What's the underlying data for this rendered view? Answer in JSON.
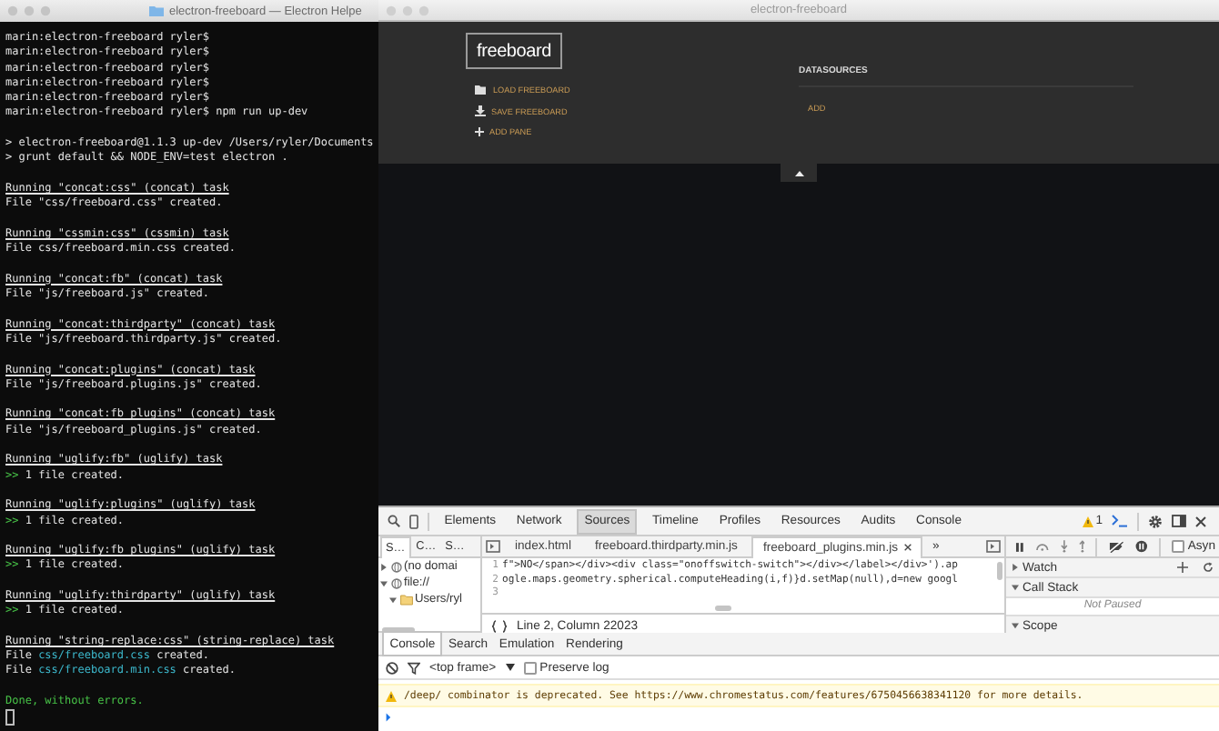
{
  "terminal": {
    "title": "electron-freeboard — Electron Helpe",
    "lines": [
      {
        "kind": "prompt",
        "text": "marin:electron-freeboard ryler$"
      },
      {
        "kind": "prompt",
        "text": "marin:electron-freeboard ryler$"
      },
      {
        "kind": "prompt",
        "text": "marin:electron-freeboard ryler$"
      },
      {
        "kind": "prompt",
        "text": "marin:electron-freeboard ryler$"
      },
      {
        "kind": "prompt",
        "text": "marin:electron-freeboard ryler$"
      },
      {
        "kind": "prompt",
        "text": "marin:electron-freeboard ryler$ npm run up-dev"
      },
      {
        "kind": "blank"
      },
      {
        "kind": "output",
        "text": "> electron-freeboard@1.1.3 up-dev /Users/ryler/Documents"
      },
      {
        "kind": "output",
        "text": "> grunt default && NODE_ENV=test electron ."
      },
      {
        "kind": "blank"
      },
      {
        "kind": "task",
        "text": "Running \"concat:css\" (concat) task"
      },
      {
        "kind": "output",
        "text": "File \"css/freeboard.css\" created."
      },
      {
        "kind": "blank"
      },
      {
        "kind": "task",
        "text": "Running \"cssmin:css\" (cssmin) task"
      },
      {
        "kind": "output",
        "text": "File css/freeboard.min.css created."
      },
      {
        "kind": "blank"
      },
      {
        "kind": "task",
        "text": "Running \"concat:fb\" (concat) task"
      },
      {
        "kind": "output",
        "text": "File \"js/freeboard.js\" created."
      },
      {
        "kind": "blank"
      },
      {
        "kind": "task",
        "text": "Running \"concat:thirdparty\" (concat) task"
      },
      {
        "kind": "output",
        "text": "File \"js/freeboard.thirdparty.js\" created."
      },
      {
        "kind": "blank"
      },
      {
        "kind": "task",
        "text": "Running \"concat:plugins\" (concat) task"
      },
      {
        "kind": "output",
        "text": "File \"js/freeboard.plugins.js\" created."
      },
      {
        "kind": "blank"
      },
      {
        "kind": "task",
        "text": "Running \"concat:fb_plugins\" (concat) task"
      },
      {
        "kind": "output",
        "text": "File \"js/freeboard_plugins.js\" created."
      },
      {
        "kind": "blank"
      },
      {
        "kind": "task",
        "text": "Running \"uglify:fb\" (uglify) task"
      },
      {
        "kind": "ok",
        "mark": ">>",
        "text": "1 file created."
      },
      {
        "kind": "blank"
      },
      {
        "kind": "task",
        "text": "Running \"uglify:plugins\" (uglify) task"
      },
      {
        "kind": "ok",
        "mark": ">>",
        "text": "1 file created."
      },
      {
        "kind": "blank"
      },
      {
        "kind": "task",
        "text": "Running \"uglify:fb_plugins\" (uglify) task"
      },
      {
        "kind": "ok",
        "mark": ">>",
        "text": "1 file created."
      },
      {
        "kind": "blank"
      },
      {
        "kind": "task",
        "text": "Running \"uglify:thirdparty\" (uglify) task"
      },
      {
        "kind": "ok",
        "mark": ">>",
        "text": "1 file created."
      },
      {
        "kind": "blank"
      },
      {
        "kind": "task",
        "text": "Running \"string-replace:css\" (string-replace) task"
      },
      {
        "kind": "file",
        "prefix": "File",
        "path": "css/freeboard.css",
        "suffix": "created."
      },
      {
        "kind": "file",
        "prefix": "File",
        "path": "css/freeboard.min.css",
        "suffix": "created."
      },
      {
        "kind": "blank"
      },
      {
        "kind": "done",
        "text": "Done, without errors."
      },
      {
        "kind": "cursor"
      }
    ]
  },
  "app_window": {
    "title": "electron-freeboard",
    "logo": "freeboard",
    "menu": [
      {
        "label": "LOAD FREEBOARD"
      },
      {
        "label": "SAVE FREEBOARD"
      },
      {
        "label": "ADD PANE"
      }
    ],
    "datasources": {
      "heading": "DATASOURCES",
      "add": "ADD"
    }
  },
  "devtools": {
    "panel_tabs": [
      {
        "label": "Elements",
        "selected": false
      },
      {
        "label": "Network",
        "selected": false
      },
      {
        "label": "Sources",
        "selected": true
      },
      {
        "label": "Timeline",
        "selected": false
      },
      {
        "label": "Profiles",
        "selected": false
      },
      {
        "label": "Resources",
        "selected": false
      },
      {
        "label": "Audits",
        "selected": false
      },
      {
        "label": "Console",
        "selected": false
      }
    ],
    "warning_count": "1",
    "navigator_tabs": [
      {
        "label": "S…",
        "selected": true
      },
      {
        "label": "C…",
        "selected": false
      },
      {
        "label": "S…",
        "selected": false
      }
    ],
    "tree": [
      {
        "label": "(no domai",
        "expanded": false
      },
      {
        "label": "file://",
        "expanded": true,
        "children": [
          {
            "label": "Users/ryl",
            "expanded": true
          }
        ]
      }
    ],
    "editor_tabs": [
      {
        "label": "index.html",
        "selected": false
      },
      {
        "label": "freeboard.thirdparty.min.js",
        "selected": false
      },
      {
        "label": "freeboard_plugins.min.js",
        "selected": true
      }
    ],
    "overflow": "»",
    "code_lines": [
      {
        "number": "1",
        "text": "f\">NO</span></div><div class=\"onoffswitch-switch\"></div></label></div>').ap"
      },
      {
        "number": "2",
        "text": "ogle.maps.geometry.spherical.computeHeading(i,f)}d.setMap(null),d=new googl"
      },
      {
        "number": "3"
      }
    ],
    "status": "Line 2, Column 22023",
    "async": {
      "label": "Asyn",
      "checked": false
    },
    "sidebar_sections": [
      {
        "title": "Watch",
        "expanded": false
      },
      {
        "title": "Call Stack",
        "expanded": true,
        "note": "Not Paused"
      },
      {
        "title": "Scope",
        "expanded": true
      }
    ],
    "drawer_tabs": [
      {
        "label": "Console",
        "selected": true
      },
      {
        "label": "Search",
        "selected": false
      },
      {
        "label": "Emulation",
        "selected": false
      },
      {
        "label": "Rendering",
        "selected": false
      }
    ],
    "context": "<top frame>",
    "preserve_log": {
      "label": "Preserve log",
      "checked": false
    },
    "messages": [
      {
        "kind": "warning",
        "text": "/deep/ combinator is deprecated. See https://www.chromestatus.com/features/6750456638341120 for more details."
      }
    ]
  }
}
